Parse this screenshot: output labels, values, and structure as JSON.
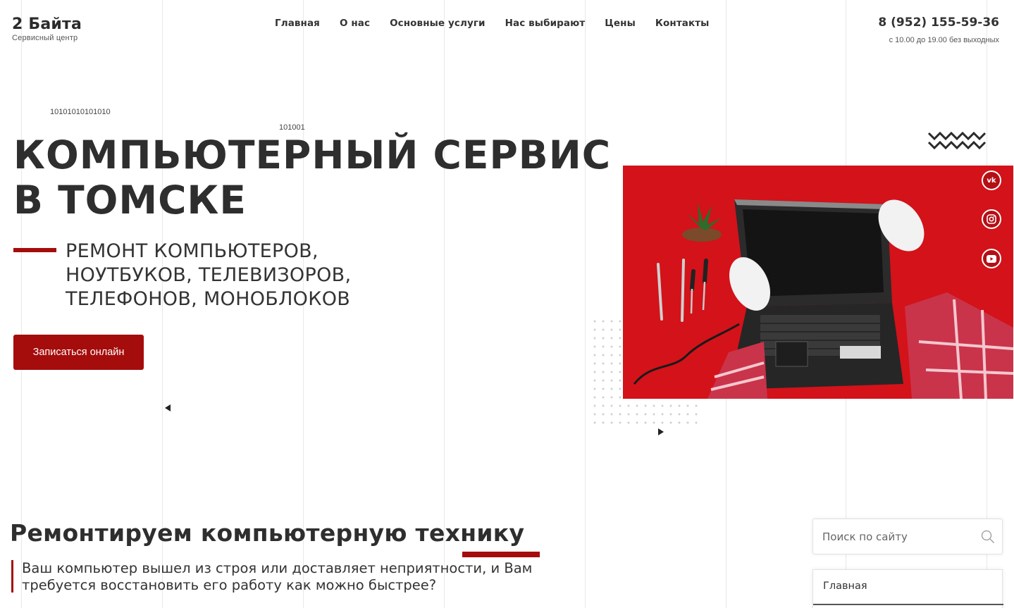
{
  "header": {
    "logo_title": "2 Байта",
    "logo_subtitle": "Сервисный центр",
    "nav": [
      "Главная",
      "О нас",
      "Основные услуги",
      "Нас выбирают",
      "Цены",
      "Контакты"
    ],
    "phone": "8 (952) 155-59-36",
    "hours": "с 10.00 до 19.00 без выходных"
  },
  "hero": {
    "binary_1": "10101010101010",
    "binary_2": "101001",
    "title_line1": "КОМПЬЮТЕРНЫЙ СЕРВИС",
    "title_line2": "В ТОМСКЕ",
    "subtitle_line1": "РЕМОНТ КОМПЬЮТЕРОВ,",
    "subtitle_line2": "НОУТБУКОВ, ТЕЛЕВИЗОРОВ,",
    "subtitle_line3": "ТЕЛЕФОНОВ, МОНОБЛОКОВ",
    "cta_label": "Записаться онлайн"
  },
  "social": {
    "icons": [
      "vk-icon",
      "instagram-icon",
      "youtube-icon"
    ],
    "vk_label": "vk"
  },
  "section": {
    "title": "Ремонтируем компьютерную технику",
    "text_line1": "Ваш компьютер вышел из строя или доставляет неприятности, и Вам",
    "text_line2": "требуется восстановить его работу как можно быстрее?"
  },
  "sidebar": {
    "search_placeholder": "Поиск по сайту",
    "menu_item": "Главная"
  },
  "colors": {
    "accent": "#a50c0c",
    "hero_image_bg": "#d3121a"
  }
}
